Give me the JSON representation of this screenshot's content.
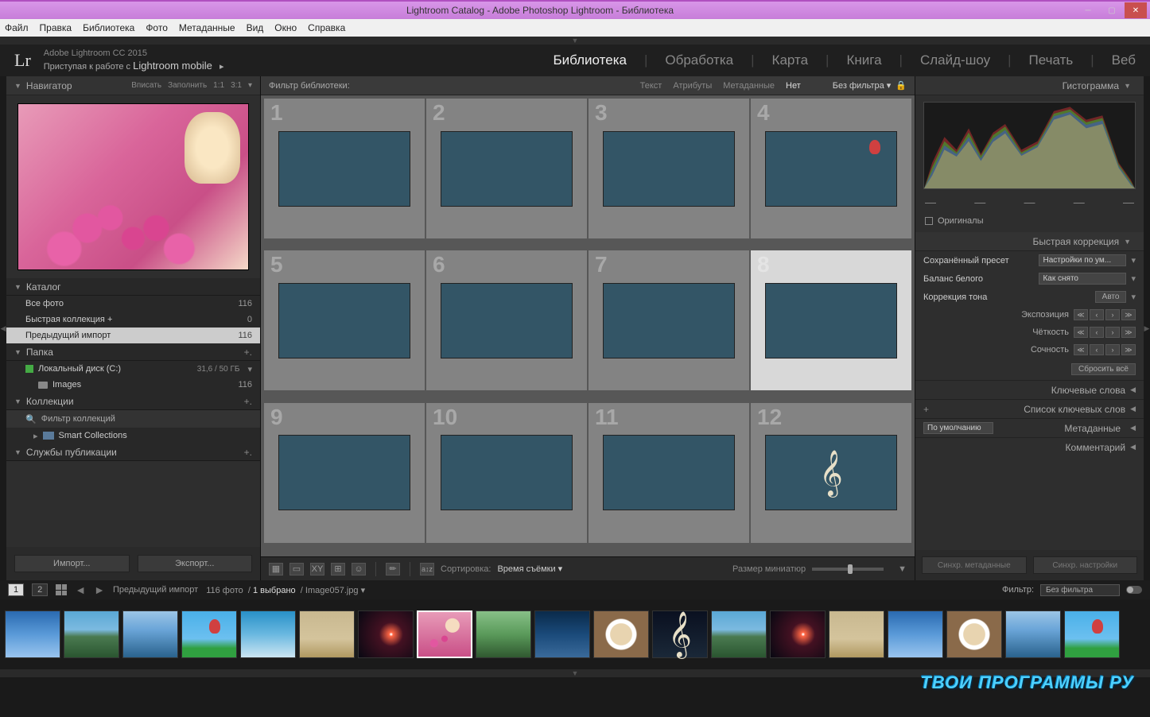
{
  "window": {
    "title": "Lightroom Catalog - Adobe Photoshop Lightroom - Библиотека"
  },
  "menubar": [
    "Файл",
    "Правка",
    "Библиотека",
    "Фото",
    "Метаданные",
    "Вид",
    "Окно",
    "Справка"
  ],
  "header": {
    "logo": "Lr",
    "line1": "Adobe Lightroom CC 2015",
    "line2_prefix": "Приступая к работе с ",
    "line2_bold": "Lightroom mobile",
    "modules": [
      "Библиотека",
      "Обработка",
      "Карта",
      "Книга",
      "Слайд-шоу",
      "Печать",
      "Веб"
    ],
    "active_module": 0
  },
  "navigator": {
    "title": "Навигатор",
    "opts": [
      "Вписать",
      "Заполнить",
      "1:1",
      "3:1"
    ]
  },
  "catalog": {
    "title": "Каталог",
    "rows": [
      {
        "label": "Все фото",
        "count": "116"
      },
      {
        "label": "Быстрая коллекция  +",
        "count": "0"
      },
      {
        "label": "Предыдущий импорт",
        "count": "116",
        "selected": true
      }
    ]
  },
  "folders": {
    "title": "Папка",
    "disk": {
      "label": "Локальный диск (C:)",
      "usage": "31,6 / 50 ГБ"
    },
    "sub": {
      "label": "Images",
      "count": "116"
    }
  },
  "collections": {
    "title": "Коллекции",
    "filter_placeholder": "Фильтр коллекций",
    "smart": "Smart Collections"
  },
  "publish": {
    "title": "Службы публикации"
  },
  "ie": {
    "import": "Импорт...",
    "export": "Экспорт..."
  },
  "filterbar": {
    "label": "Фильтр библиотеки:",
    "tabs": [
      "Текст",
      "Атрибуты",
      "Метаданные",
      "Нет"
    ],
    "active_tab": 3,
    "dropdown": "Без фильтра"
  },
  "grid": {
    "cells": [
      1,
      2,
      3,
      4,
      5,
      6,
      7,
      8,
      9,
      10,
      11,
      12
    ],
    "selected": 8,
    "thumb_classes": [
      "th-sky1",
      "th-mtn",
      "th-sea",
      "th-balloon",
      "th-clouds",
      "th-zebra",
      "th-space",
      "th-roses",
      "th-castle",
      "th-dragon",
      "th-coffee",
      "th-treble"
    ]
  },
  "grid_toolbar": {
    "sort_label": "Сортировка:",
    "sort_value": "Время съёмки",
    "size_label": "Размер миниатюр"
  },
  "right": {
    "histogram": "Гистограмма",
    "originals": "Оригиналы",
    "quick_dev": "Быстрая коррекция",
    "preset_label": "Сохранённый пресет",
    "preset_value": "Настройки по ум...",
    "wb_label": "Баланс белого",
    "wb_value": "Как снято",
    "tone_label": "Коррекция тона",
    "auto": "Авто",
    "exposure": "Экспозиция",
    "clarity": "Чёткость",
    "vibrance": "Сочность",
    "reset": "Сбросить всё",
    "keywords": "Ключевые слова",
    "keyword_list": "Список ключевых слов",
    "metadata": "Метаданные",
    "metadata_select": "По умолчанию",
    "comments": "Комментарий",
    "sync_meta": "Синхр. метаданные",
    "sync_settings": "Синхр. настройки"
  },
  "statusbar": {
    "pages": [
      "1",
      "2"
    ],
    "breadcrumb": "Предыдущий импорт",
    "count_text": "116 фото",
    "selected_text": "1 выбрано",
    "filename": "Image057.jpg",
    "filter_label": "Фильтр:",
    "filter_value": "Без фильтра"
  },
  "filmstrip_classes": [
    "th-sky1",
    "th-mtn",
    "th-sea",
    "th-balloon",
    "th-clouds",
    "th-zebra",
    "th-space",
    "th-roses",
    "th-castle",
    "th-dragon",
    "th-coffee",
    "th-treble",
    "th-mtn",
    "th-space",
    "th-zebra",
    "th-sky1",
    "th-coffee",
    "th-sea",
    "th-balloon"
  ],
  "watermark": "ТВОИ ПРОГРАММЫ РУ"
}
